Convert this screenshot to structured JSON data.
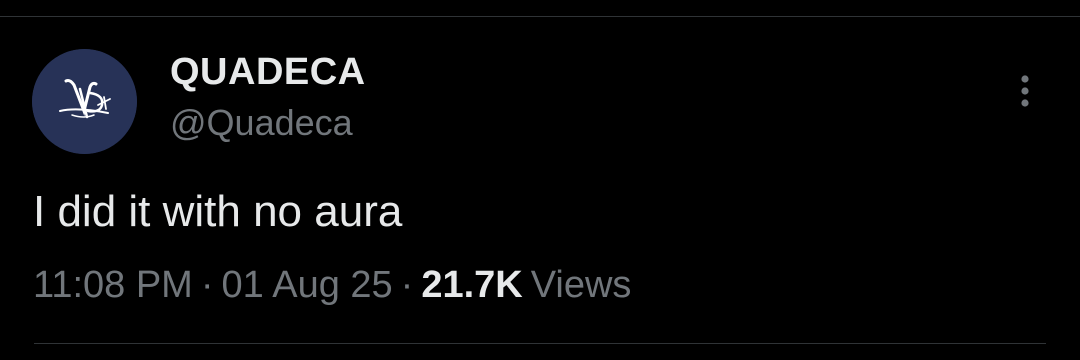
{
  "tweet": {
    "author": {
      "display_name": "QUADECA",
      "handle": "@Quadeca",
      "avatar_icon": "qd-monogram-avatar",
      "avatar_bg": "#273257"
    },
    "text": "I did it with no aura",
    "time": "11:08 PM",
    "separator": "·",
    "date": "01 Aug 25",
    "views_count": "21.7K",
    "views_label": "Views",
    "more_icon": "vertical-ellipsis-icon"
  },
  "colors": {
    "background": "#000000",
    "primary_text": "#e7e9ea",
    "secondary_text": "#71767b",
    "divider": "#2f3336"
  }
}
